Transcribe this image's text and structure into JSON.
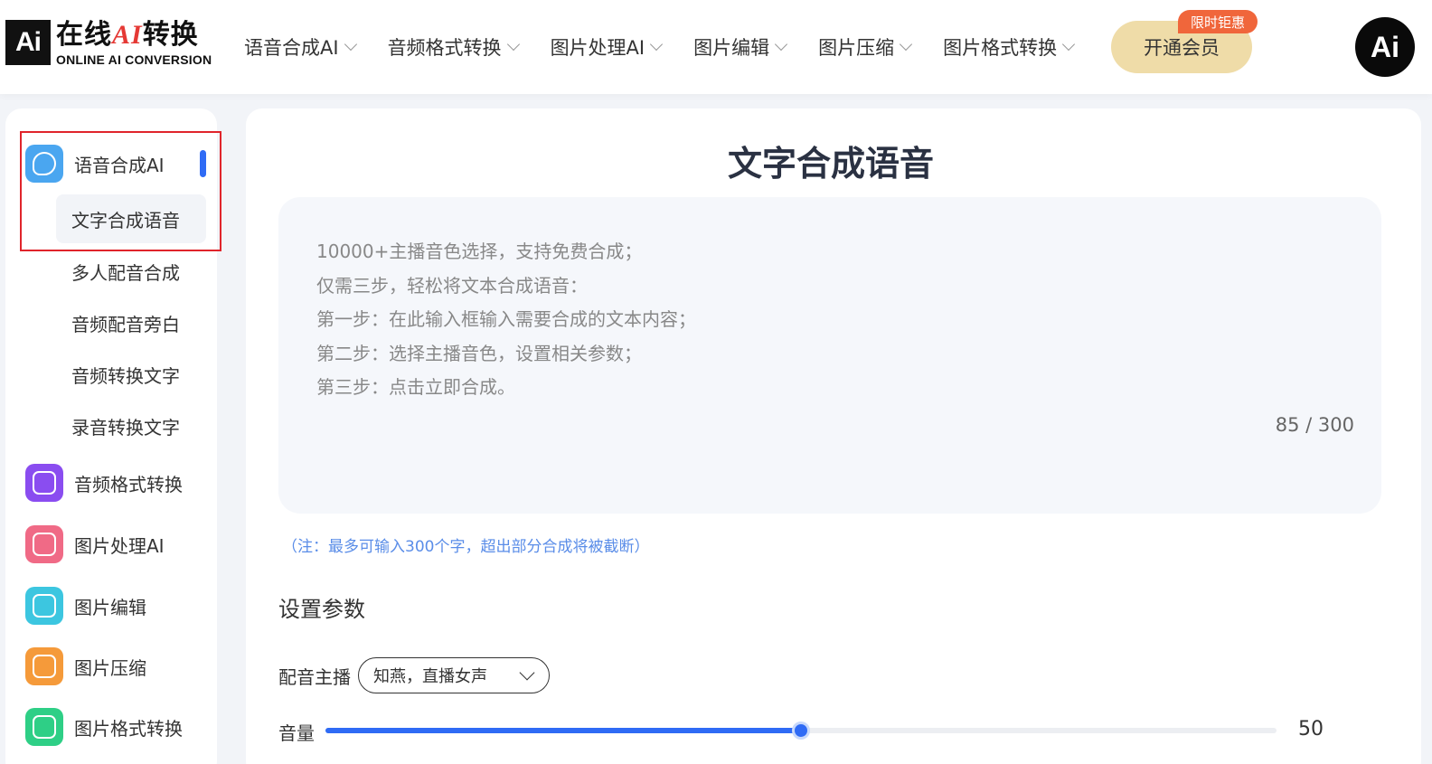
{
  "header": {
    "logo_mark": "Ai",
    "logo_cn_prefix": "在线",
    "logo_cn_ai": "AI",
    "logo_cn_suffix": "转换",
    "logo_en": "ONLINE AI CONVERSION",
    "nav": [
      {
        "label": "语音合成AI"
      },
      {
        "label": "音频格式转换"
      },
      {
        "label": "图片处理AI"
      },
      {
        "label": "图片编辑"
      },
      {
        "label": "图片压缩"
      },
      {
        "label": "图片格式转换"
      }
    ],
    "vip_label": "开通会员",
    "vip_tag": "限时钜惠",
    "avatar_text": "Ai"
  },
  "sidebar": {
    "groups": [
      {
        "label": "语音合成AI",
        "icon": "voice-icon",
        "color": "#4aa6f0"
      },
      {
        "label": "音频格式转换",
        "icon": "audio-convert-icon",
        "color": "#8a4df0"
      },
      {
        "label": "图片处理AI",
        "icon": "image-ai-icon",
        "color": "#f06a86"
      },
      {
        "label": "图片编辑",
        "icon": "image-edit-icon",
        "color": "#3cc6e0"
      },
      {
        "label": "图片压缩",
        "icon": "image-compress-icon",
        "color": "#f59a3a"
      },
      {
        "label": "图片格式转换",
        "icon": "image-convert-icon",
        "color": "#2ecf86"
      }
    ],
    "sub_items": [
      {
        "label": "文字合成语音",
        "active": true
      },
      {
        "label": "多人配音合成"
      },
      {
        "label": "音频配音旁白"
      },
      {
        "label": "音频转换文字"
      },
      {
        "label": "录音转换文字"
      }
    ]
  },
  "main": {
    "title": "文字合成语音",
    "textarea_lines": [
      "10000+主播音色选择，支持免费合成；",
      "仅需三步，轻松将文本合成语音：",
      "第一步：在此输入框输入需要合成的文本内容；",
      "第二步：选择主播音色，设置相关参数；",
      "第三步：点击立即合成。"
    ],
    "counter": "85 / 300",
    "note": "（注：最多可输入300个字，超出部分合成将被截断）",
    "section_title": "设置参数",
    "voice_label": "配音主播",
    "voice_value": "知燕，直播女声",
    "volume_label": "音量",
    "volume_value": "50",
    "volume_percent": 50
  },
  "colors": {
    "accent": "#2f6bf5",
    "vip": "#efdca8",
    "tag": "#f0663b",
    "highlight": "#e0242b"
  }
}
